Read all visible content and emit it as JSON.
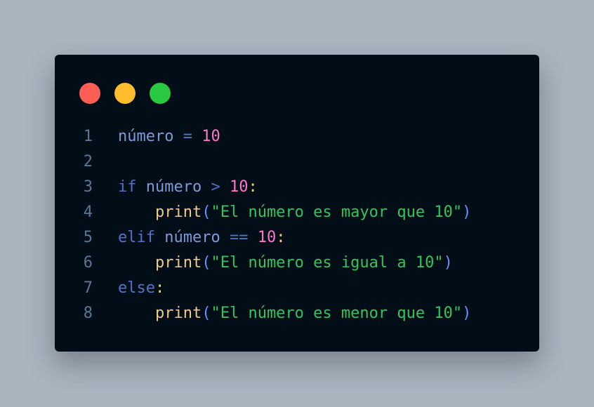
{
  "window": {
    "controls": [
      {
        "name": "close",
        "color": "#ff5f57"
      },
      {
        "name": "minimize",
        "color": "#febc2e"
      },
      {
        "name": "maximize",
        "color": "#28c840"
      }
    ]
  },
  "code": {
    "lines": [
      {
        "number": "1",
        "tokens": [
          {
            "type": "var",
            "text": "número"
          },
          {
            "type": "text",
            "text": " "
          },
          {
            "type": "op",
            "text": "="
          },
          {
            "type": "text",
            "text": " "
          },
          {
            "type": "num",
            "text": "10"
          }
        ]
      },
      {
        "number": "2",
        "tokens": []
      },
      {
        "number": "3",
        "tokens": [
          {
            "type": "kw",
            "text": "if"
          },
          {
            "type": "text",
            "text": " "
          },
          {
            "type": "var",
            "text": "número"
          },
          {
            "type": "text",
            "text": " "
          },
          {
            "type": "op",
            "text": ">"
          },
          {
            "type": "text",
            "text": " "
          },
          {
            "type": "num",
            "text": "10"
          },
          {
            "type": "punct",
            "text": ":"
          }
        ]
      },
      {
        "number": "4",
        "tokens": [
          {
            "type": "text",
            "text": "    "
          },
          {
            "type": "fn",
            "text": "print"
          },
          {
            "type": "paren",
            "text": "("
          },
          {
            "type": "str",
            "text": "\"El número es mayor que 10\""
          },
          {
            "type": "paren",
            "text": ")"
          }
        ]
      },
      {
        "number": "5",
        "tokens": [
          {
            "type": "kw",
            "text": "elif"
          },
          {
            "type": "text",
            "text": " "
          },
          {
            "type": "var",
            "text": "número"
          },
          {
            "type": "text",
            "text": " "
          },
          {
            "type": "op",
            "text": "=="
          },
          {
            "type": "text",
            "text": " "
          },
          {
            "type": "num",
            "text": "10"
          },
          {
            "type": "punct",
            "text": ":"
          }
        ]
      },
      {
        "number": "6",
        "tokens": [
          {
            "type": "text",
            "text": "    "
          },
          {
            "type": "fn",
            "text": "print"
          },
          {
            "type": "paren",
            "text": "("
          },
          {
            "type": "str",
            "text": "\"El número es igual a 10\""
          },
          {
            "type": "paren",
            "text": ")"
          }
        ]
      },
      {
        "number": "7",
        "tokens": [
          {
            "type": "kw",
            "text": "else"
          },
          {
            "type": "punct",
            "text": ":"
          }
        ]
      },
      {
        "number": "8",
        "tokens": [
          {
            "type": "text",
            "text": "    "
          },
          {
            "type": "fn",
            "text": "print"
          },
          {
            "type": "paren",
            "text": "("
          },
          {
            "type": "str",
            "text": "\"El número es menor que 10\""
          },
          {
            "type": "paren",
            "text": ")"
          }
        ]
      }
    ]
  }
}
